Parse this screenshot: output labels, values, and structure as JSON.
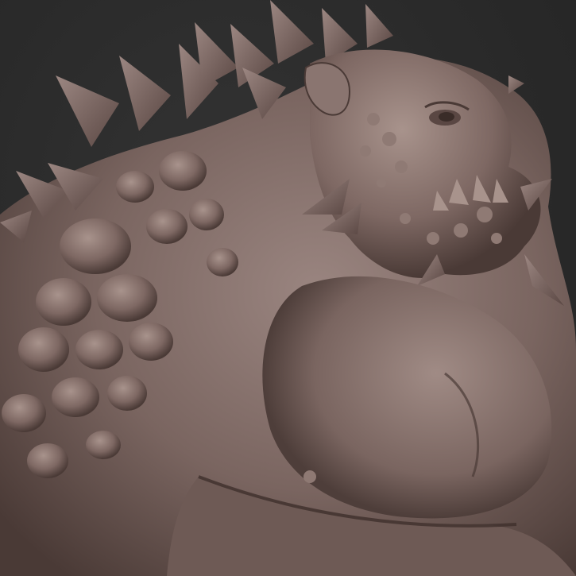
{
  "viewport": {
    "background_color": "#2b2b2b",
    "sculpt_base_color": "#7a6560",
    "sculpt_shadow_color": "#3e302c",
    "sculpt_highlight_color": "#a8938c"
  },
  "subject": {
    "icon": "creature-sculpt"
  }
}
